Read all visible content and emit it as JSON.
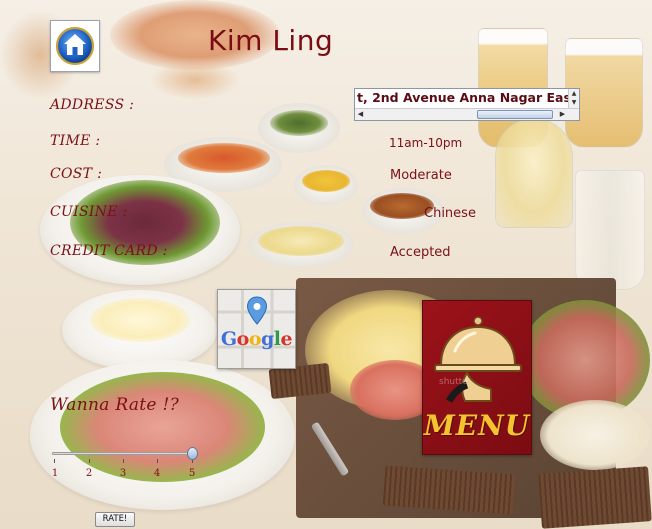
{
  "restaurant": {
    "name": "Kim Ling"
  },
  "details": {
    "address_label": "ADDRESS :",
    "address_value": "t, 2nd Avenue Anna Nagar East",
    "time_label": "TIME :",
    "time_value": "11am-10pm",
    "cost_label": "COST :",
    "cost_value": "Moderate",
    "cuisine_label": "CUISINE :",
    "cuisine_value": "Chinese",
    "credit_label": "CREDIT CARD :",
    "credit_value": "Accepted"
  },
  "map_button": {
    "logo_letters": [
      "G",
      "o",
      "o",
      "g",
      "l",
      "e"
    ],
    "logo_colors": [
      "#3f6fd8",
      "#d8342c",
      "#f1b30d",
      "#3f6fd8",
      "#2e9b44",
      "#d8342c"
    ]
  },
  "menu_button": {
    "label": "MENU",
    "watermark": "shutte"
  },
  "rating": {
    "prompt": "Wanna Rate !?",
    "scale": [
      "1",
      "2",
      "3",
      "4",
      "5"
    ],
    "selected": 5,
    "button_label": "RATE!"
  },
  "colors": {
    "label": "#7a1018",
    "title": "#7a0d14",
    "menu_gold": "#f3c430",
    "menu_red": "#9c121a"
  },
  "icons": {
    "home": "home-icon",
    "map_pin": "map-pin-icon",
    "cloche": "cloche-icon"
  }
}
